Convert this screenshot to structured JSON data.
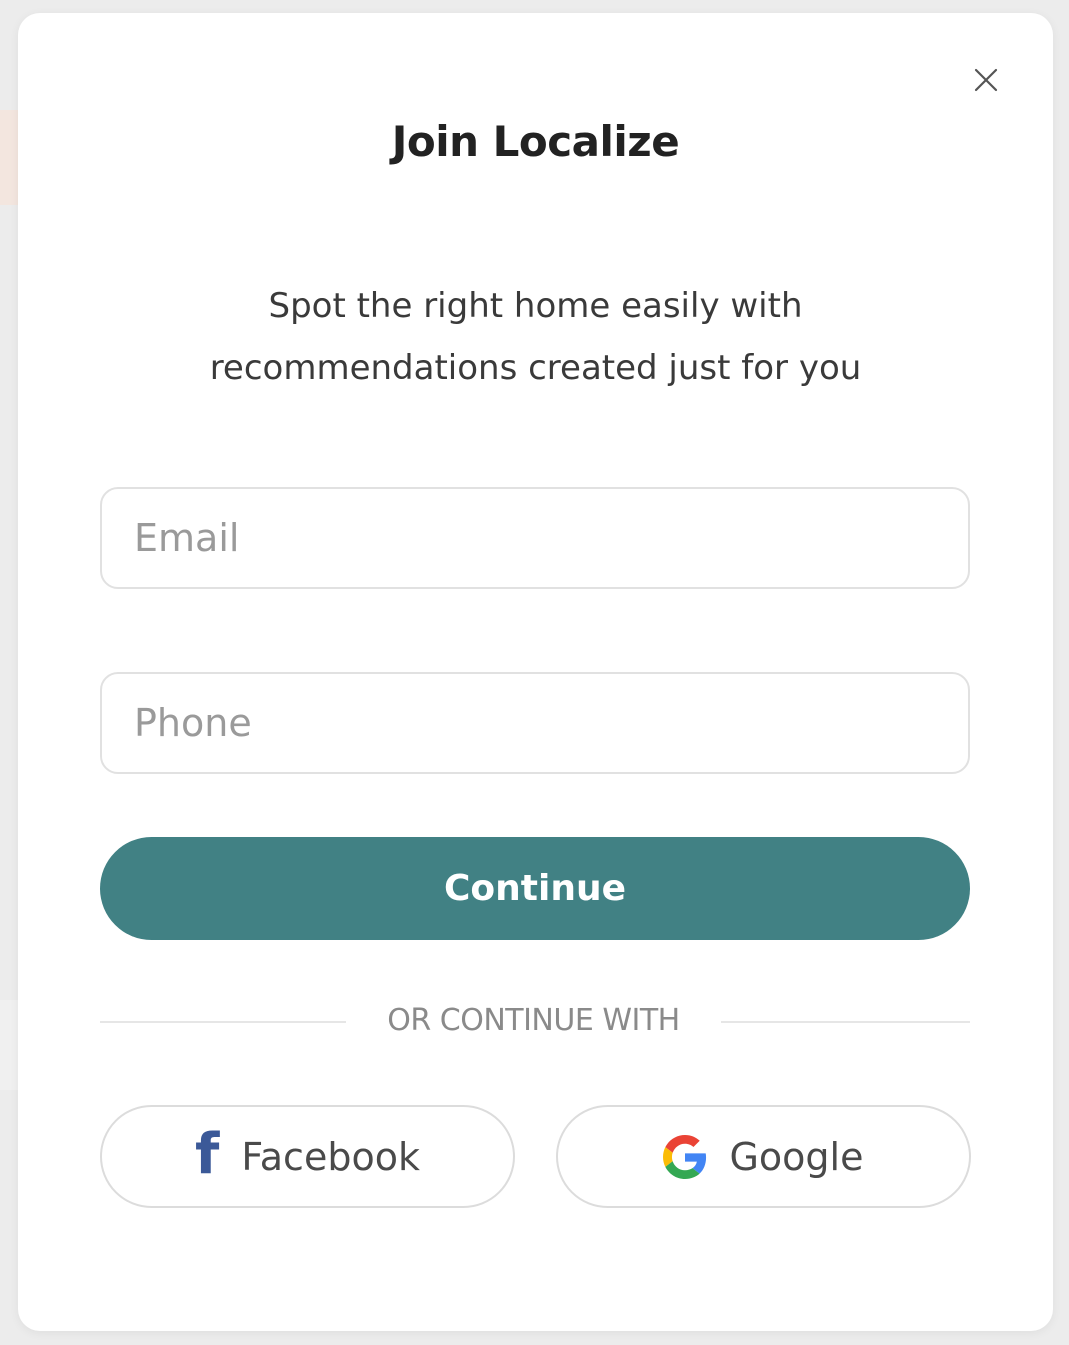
{
  "modal": {
    "title": "Join Localize",
    "subtitle_line1": "Spot the right home easily with",
    "subtitle_line2": "recommendations created just for you",
    "close_icon": "close-icon"
  },
  "form": {
    "email_placeholder": "Email",
    "email_value": "",
    "phone_placeholder": "Phone",
    "phone_value": "",
    "continue_label": "Continue"
  },
  "divider": {
    "text": "OR CONTINUE WITH"
  },
  "social": {
    "facebook_label": "Facebook",
    "facebook_icon": "facebook-icon",
    "google_label": "Google",
    "google_icon": "google-icon"
  },
  "colors": {
    "primary": "#418184",
    "facebook": "#3b5998"
  }
}
